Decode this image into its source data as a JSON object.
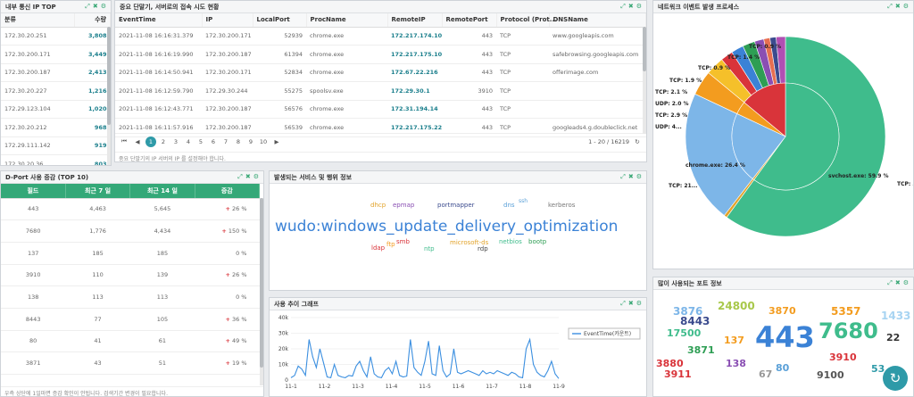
{
  "panel_ip_top": {
    "title": "내부 통신 IP TOP",
    "headers": [
      "분류",
      "수량"
    ],
    "rows": [
      {
        "ip": "172.30.20.251",
        "count": "3,808"
      },
      {
        "ip": "172.30.200.171",
        "count": "3,449"
      },
      {
        "ip": "172.30.200.187",
        "count": "2,413"
      },
      {
        "ip": "172.30.20.227",
        "count": "1,216"
      },
      {
        "ip": "172.29.123.104",
        "count": "1,020"
      },
      {
        "ip": "172.30.20.212",
        "count": "968"
      },
      {
        "ip": "172.29.111.142",
        "count": "919"
      },
      {
        "ip": "172.30.20.36",
        "count": "803"
      }
    ]
  },
  "panel_events": {
    "title": "중요 단말기, 서버로의 접속 시도 현황",
    "headers": [
      "EventTime",
      "IP",
      "LocalPort",
      "ProcName",
      "RemoteIP",
      "RemotePort",
      "Protocol (Prot...",
      "DNSName"
    ],
    "rows": [
      {
        "time": "2021-11-08 16:16:31.379",
        "ip": "172.30.200.171",
        "lport": "52939",
        "proc": "chrome.exe",
        "rip": "172.217.174.106",
        "rport": "443",
        "proto": "TCP",
        "dns": "www.googleapis.com"
      },
      {
        "time": "2021-11-08 16:16:19.990",
        "ip": "172.30.200.187",
        "lport": "61394",
        "proc": "chrome.exe",
        "rip": "172.217.175.10",
        "rport": "443",
        "proto": "TCP",
        "dns": "safebrowsing.googleapis.com"
      },
      {
        "time": "2021-11-08 16:14:50.941",
        "ip": "172.30.200.171",
        "lport": "52834",
        "proc": "chrome.exe",
        "rip": "172.67.22.216",
        "rport": "443",
        "proto": "TCP",
        "dns": "offerimage.com"
      },
      {
        "time": "2021-11-08 16:12:59.790",
        "ip": "172.29.30.244",
        "lport": "55275",
        "proc": "spoolsv.exe",
        "rip": "172.29.30.1",
        "rport": "3910",
        "proto": "TCP",
        "dns": ""
      },
      {
        "time": "2021-11-08 16:12:43.771",
        "ip": "172.30.200.187",
        "lport": "56576",
        "proc": "chrome.exe",
        "rip": "172.31.194.14",
        "rport": "443",
        "proto": "TCP",
        "dns": ""
      },
      {
        "time": "2021-11-08 16:11:57.916",
        "ip": "172.30.200.187",
        "lport": "56539",
        "proc": "chrome.exe",
        "rip": "172.217.175.226",
        "rport": "443",
        "proto": "TCP",
        "dns": "googleads4.g.doubleclick.net"
      }
    ],
    "pagination": {
      "pages": [
        "1",
        "2",
        "3",
        "4",
        "5",
        "6",
        "7",
        "8",
        "9",
        "10"
      ],
      "range": "1 - 20 / 16219"
    },
    "footer": "중요 단말기의 IP 서버의 IP 를 설정해야 합니다."
  },
  "panel_network": {
    "title": "네트워크 이벤트 발생 프로세스",
    "outer_labels": [
      "TCP: 0.9 %",
      "TCP: 1.4 %",
      "TCP: 0.9 %",
      "TCP: 1.9 %",
      "TCP: 2.1 %",
      "UDP: 2.0 %",
      "TCP: 2.9 %",
      "UDP: 4...",
      "TCP: 21...",
      "TCP: 59..."
    ],
    "inner_labels": [
      "chrome.exe: 26.4 %",
      "svchost.exe: 59.9 %"
    ],
    "colors": {
      "svchost": "#3fbc8c",
      "chrome": "#7db6e8",
      "orange": "#f39c1f"
    }
  },
  "panel_dport": {
    "title": "D-Port 사용 증감 (TOP 10)",
    "headers": [
      "필드",
      "최근 7 일",
      "최근 14 일",
      "증감"
    ],
    "rows": [
      {
        "port": "443",
        "d7": "4,463",
        "d14": "5,645",
        "delta": "26 %",
        "up": true
      },
      {
        "port": "7680",
        "d7": "1,776",
        "d14": "4,434",
        "delta": "150 %",
        "up": true
      },
      {
        "port": "137",
        "d7": "185",
        "d14": "185",
        "delta": "0 %",
        "up": false
      },
      {
        "port": "3910",
        "d7": "110",
        "d14": "139",
        "delta": "26 %",
        "up": true
      },
      {
        "port": "138",
        "d7": "113",
        "d14": "113",
        "delta": "0 %",
        "up": false
      },
      {
        "port": "8443",
        "d7": "77",
        "d14": "105",
        "delta": "36 %",
        "up": true
      },
      {
        "port": "80",
        "d7": "41",
        "d14": "61",
        "delta": "49 %",
        "up": true
      },
      {
        "port": "3871",
        "d7": "43",
        "d14": "51",
        "delta": "19 %",
        "up": true
      }
    ],
    "footer": "우측 상단에 1일마면 증감 확인이 안됩니다. 검색기간 변경이 필요합니다."
  },
  "panel_services": {
    "title": "발생되는 서비스 및 행위 정보",
    "words": [
      {
        "text": "dhcp",
        "color": "#e2a32a",
        "size": 7
      },
      {
        "text": "epmap",
        "color": "#8a4fb3",
        "size": 7
      },
      {
        "text": "portmapper",
        "color": "#3b4b8e",
        "size": 7
      },
      {
        "text": "dns",
        "color": "#5aa0d8",
        "size": 7
      },
      {
        "text": "ssh",
        "color": "#5aa0d8",
        "size": 6
      },
      {
        "text": "kerberos",
        "color": "#777777",
        "size": 7
      },
      {
        "text": "wudo:windows_update_delivery_optimization",
        "color": "#3b82d6",
        "size": 17
      },
      {
        "text": "ldap",
        "color": "#d9343a",
        "size": 7
      },
      {
        "text": "ftp",
        "color": "#f39c1f",
        "size": 7
      },
      {
        "text": "smb",
        "color": "#d9343a",
        "size": 7
      },
      {
        "text": "ntp",
        "color": "#3fbc8c",
        "size": 7
      },
      {
        "text": "microsoft-ds",
        "color": "#e2a32a",
        "size": 7
      },
      {
        "text": "rdp",
        "color": "#444444",
        "size": 7
      },
      {
        "text": "netbios",
        "color": "#3fbc8c",
        "size": 7
      },
      {
        "text": "bootp",
        "color": "#2e9e54",
        "size": 7
      }
    ]
  },
  "panel_trend": {
    "title": "사용 추이 그래프",
    "legend": "EventTime(카운트)",
    "chart_data": {
      "type": "line",
      "series": [
        {
          "name": "EventTime(카운트)",
          "values": [
            1500,
            3000,
            9000,
            7000,
            3000,
            26000,
            15000,
            8000,
            20000,
            11000,
            2000,
            1500,
            10000,
            3000,
            2000,
            1500,
            3000,
            2500,
            9000,
            12000,
            6000,
            2000,
            15000,
            4000,
            2000,
            1500,
            6000,
            8000,
            4000,
            12000,
            3000,
            2000,
            2500,
            26000,
            8000,
            5000,
            3000,
            12000,
            25000,
            4000,
            3000,
            22000,
            6000,
            2000,
            4000,
            20000,
            5000,
            4000,
            5000,
            6000,
            5000,
            4000,
            3000,
            6000,
            4000,
            5000,
            4000,
            6000,
            5000,
            4000,
            3000,
            5000,
            4000,
            2000,
            1500,
            20000,
            26000,
            10000,
            5000,
            3000,
            2000,
            6000,
            12000,
            4000,
            1000
          ]
        }
      ],
      "x_ticks": [
        "11-1",
        "11-2",
        "11-3",
        "11-4",
        "11-5",
        "11-6",
        "11-7",
        "11-8",
        "11-9"
      ],
      "y_ticks": [
        "40k",
        "30k",
        "20k",
        "10k",
        "0"
      ],
      "ylim": [
        0,
        40000
      ]
    }
  },
  "panel_ports": {
    "title": "많이 사용되는 포트 정보",
    "words": [
      {
        "text": "3876",
        "color": "#7db6e8",
        "size": 12
      },
      {
        "text": "24800",
        "color": "#a8c84b",
        "size": 12
      },
      {
        "text": "3870",
        "color": "#f39c1f",
        "size": 11
      },
      {
        "text": "5357",
        "color": "#f39c1f",
        "size": 12
      },
      {
        "text": "1433",
        "color": "#a8d4f2",
        "size": 12
      },
      {
        "text": "8443",
        "color": "#3b4b8e",
        "size": 12
      },
      {
        "text": "17500",
        "color": "#3fbc8c",
        "size": 11
      },
      {
        "text": "137",
        "color": "#f39c1f",
        "size": 11
      },
      {
        "text": "443",
        "color": "#3b82d6",
        "size": 32
      },
      {
        "text": "7680",
        "color": "#3fbc8c",
        "size": 24
      },
      {
        "text": "22",
        "color": "#333333",
        "size": 11
      },
      {
        "text": "3871",
        "color": "#2e9e54",
        "size": 11
      },
      {
        "text": "3880",
        "color": "#d9343a",
        "size": 11
      },
      {
        "text": "138",
        "color": "#8a4fb3",
        "size": 11
      },
      {
        "text": "3910",
        "color": "#d9343a",
        "size": 11
      },
      {
        "text": "3911",
        "color": "#d9343a",
        "size": 11
      },
      {
        "text": "67",
        "color": "#999999",
        "size": 11
      },
      {
        "text": "80",
        "color": "#5aa0d8",
        "size": 11
      },
      {
        "text": "9100",
        "color": "#555555",
        "size": 11
      },
      {
        "text": "53",
        "color": "#2e9aa8",
        "size": 11
      }
    ]
  }
}
